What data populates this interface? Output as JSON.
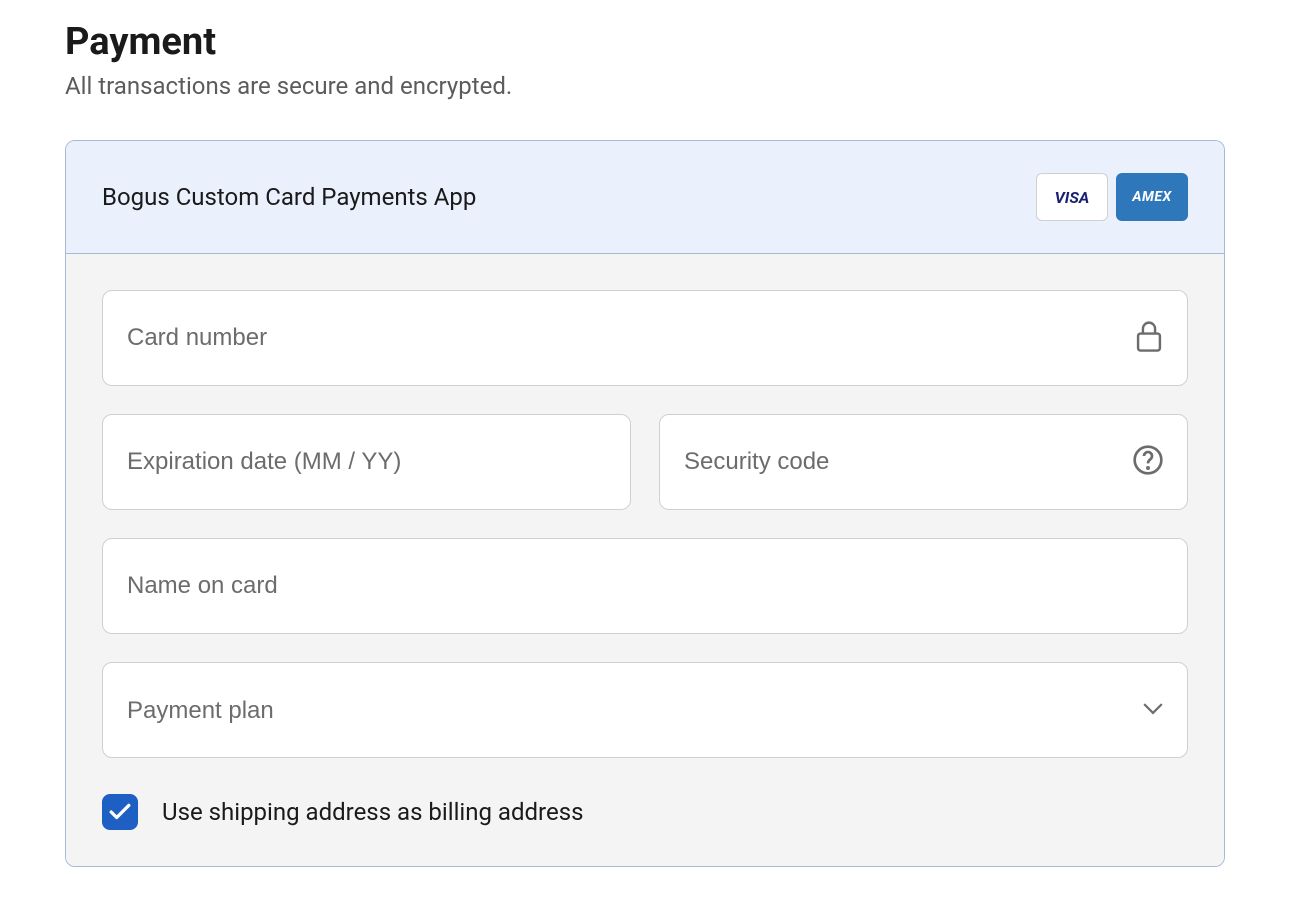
{
  "payment": {
    "title": "Payment",
    "subtitle": "All transactions are secure and encrypted.",
    "method_name": "Bogus Custom Card Payments App",
    "card_brands": [
      "VISA",
      "AMEX"
    ],
    "fields": {
      "card_number_placeholder": "Card number",
      "expiration_placeholder": "Expiration date (MM / YY)",
      "security_code_placeholder": "Security code",
      "name_on_card_placeholder": "Name on card",
      "payment_plan_placeholder": "Payment plan"
    },
    "checkbox": {
      "checked": true,
      "label": "Use shipping address as billing address"
    }
  }
}
